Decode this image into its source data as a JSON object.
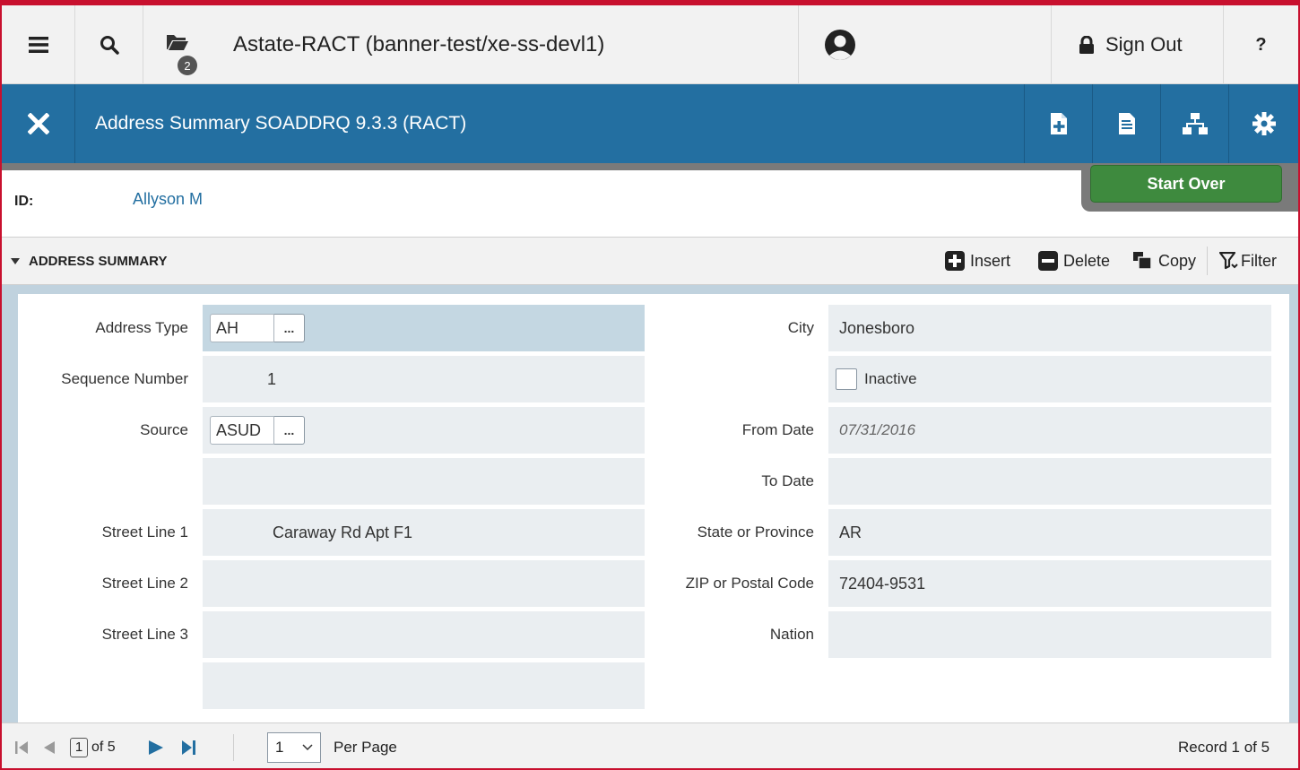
{
  "topbar": {
    "menu_icon": "hamburger-icon",
    "search_icon": "search-icon",
    "recent_icon": "folder-icon",
    "recent_count": "2",
    "title": "Astate-RACT (banner-test/xe-ss-devl1)",
    "user_icon": "user-avatar-icon",
    "signout_label": "Sign Out",
    "help_label": "?"
  },
  "pageheader": {
    "title": "Address Summary SOADDRQ 9.3.3 (RACT)",
    "close_icon": "close-icon",
    "actions": [
      "add-document-icon",
      "related-icon",
      "hierarchy-icon",
      "settings-icon"
    ]
  },
  "keyblock": {
    "id_label": "ID:",
    "id_value": "Allyson M",
    "start_over_label": "Start Over"
  },
  "section": {
    "title": "ADDRESS SUMMARY",
    "insert_label": "Insert",
    "delete_label": "Delete",
    "copy_label": "Copy",
    "filter_label": "Filter"
  },
  "form": {
    "address_type_label": "Address Type",
    "address_type_value": "AH",
    "sequence_label": "Sequence Number",
    "sequence_value": "1",
    "source_label": "Source",
    "source_value": "ASUD",
    "street1_label": "Street Line 1",
    "street1_value": "Caraway Rd Apt F1",
    "street2_label": "Street Line 2",
    "street2_value": "",
    "street3_label": "Street Line 3",
    "street3_value": "",
    "city_label": "City",
    "city_value": "Jonesboro",
    "inactive_label": "Inactive",
    "inactive_checked": false,
    "from_date_label": "From Date",
    "from_date_value": "07/31/2016",
    "to_date_label": "To Date",
    "to_date_value": "",
    "state_label": "State or Province",
    "state_value": "AR",
    "zip_label": "ZIP or Postal Code",
    "zip_value": "72404-9531",
    "nation_label": "Nation",
    "nation_value": "",
    "lov_button_label": "..."
  },
  "pager": {
    "current_page": "1",
    "of_pages": "of 5",
    "per_page_value": "1",
    "per_page_label": "Per Page",
    "record_text": "Record 1 of 5"
  },
  "colors": {
    "accent_red": "#c8102e",
    "header_blue": "#236fa1",
    "start_over_green": "#3e8a3e",
    "selected_field": "#c4d7e2"
  }
}
